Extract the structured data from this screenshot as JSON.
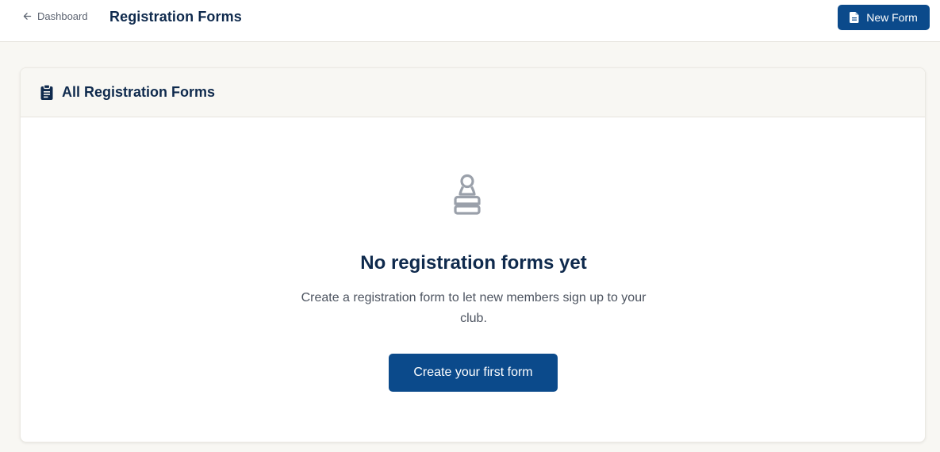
{
  "header": {
    "back_label": "Dashboard",
    "title": "Registration Forms",
    "new_form_label": "New Form"
  },
  "card": {
    "title": "All Registration Forms"
  },
  "empty_state": {
    "icon": "chess-pawn-icon",
    "title": "No registration forms yet",
    "description": "Create a registration form to let new members sign up to your club.",
    "cta_label": "Create your first form"
  },
  "colors": {
    "primary": "#0b4a8b",
    "heading": "#0f2a4d",
    "background": "#f8f7f3",
    "icon_muted": "#9aa0aa"
  }
}
